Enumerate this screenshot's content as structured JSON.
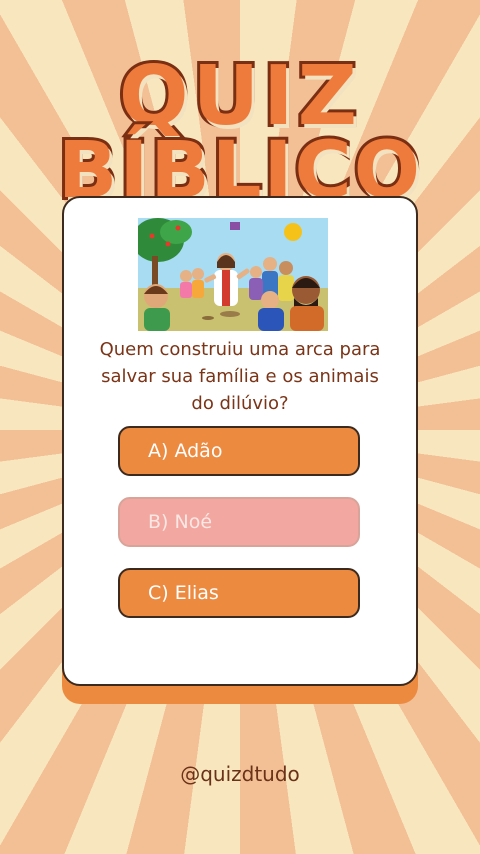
{
  "title": {
    "line1": "QUIZ",
    "line2": "BÍBLICO"
  },
  "illustration": {
    "icon": "bible-scene-illustration",
    "description_label": ""
  },
  "question": {
    "text": "Quem construiu uma arca para salvar sua família e os animais do dilúvio?"
  },
  "options": [
    {
      "label": "A) Adão",
      "state": "default"
    },
    {
      "label": "B) Noé",
      "state": "selected-faded"
    },
    {
      "label": "C) Elias",
      "state": "default"
    }
  ],
  "footer": {
    "handle": "@quizdtudo"
  },
  "colors": {
    "accent": "#ec8a40",
    "title_stroke": "#7a2e12",
    "question_text": "#7a3417",
    "faded_option": "#f2a7a1"
  }
}
